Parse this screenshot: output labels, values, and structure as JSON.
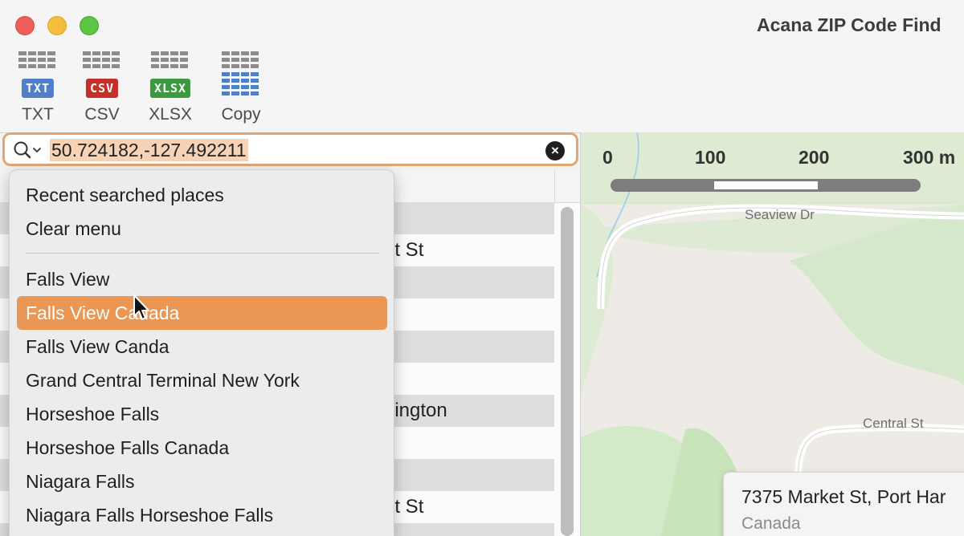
{
  "window": {
    "title": "Acana ZIP Code Find"
  },
  "toolbar": {
    "buttons": [
      {
        "label": "TXT",
        "badge": "TXT",
        "badge_color": "#4f7fc9"
      },
      {
        "label": "CSV",
        "badge": "CSV",
        "badge_color": "#c42f2a"
      },
      {
        "label": "XLSX",
        "badge": "XLSX",
        "badge_color": "#3b9a3d"
      },
      {
        "label": "Copy",
        "icon": "table-copy-icon"
      }
    ]
  },
  "search": {
    "value": "50.724182,-127.492211",
    "icon": "search-icon"
  },
  "menu": {
    "header_items": [
      "Recent searched places",
      "Clear menu"
    ],
    "items": [
      "Falls View",
      "Falls View Canada",
      "Falls View Canda",
      "Grand Central Terminal New York",
      "Horseshoe Falls",
      "Horseshoe Falls Canada",
      "Niagara Falls",
      "Niagara Falls Horseshoe Falls"
    ],
    "selected_index": 1,
    "selected_color": "#eb9653"
  },
  "table": {
    "visible_fragments": [
      "et St",
      "dington",
      "et St"
    ]
  },
  "map": {
    "scale_labels": [
      "0",
      "100",
      "200",
      "300 m"
    ],
    "streets": [
      "Seaview Dr",
      "Central St"
    ],
    "info": {
      "address": "7375 Market St, Port Har",
      "country": "Canada"
    }
  }
}
